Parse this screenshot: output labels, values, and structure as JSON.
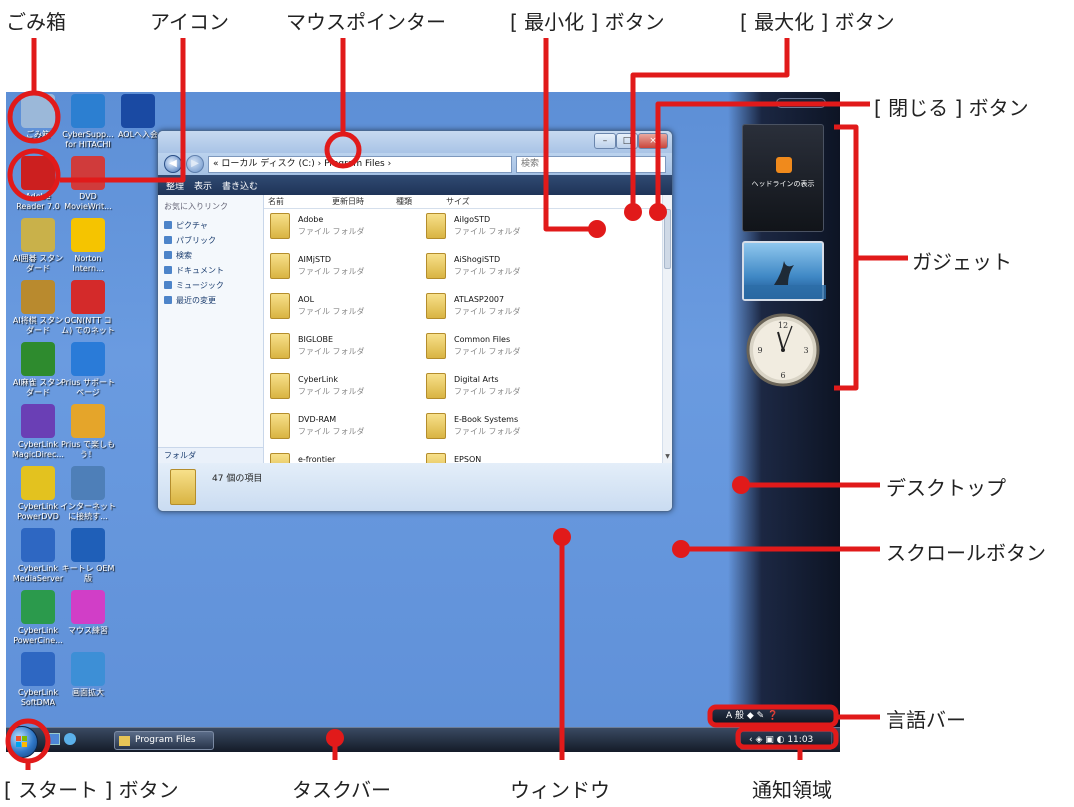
{
  "callouts": {
    "recycle_bin": "ごみ箱",
    "icon": "アイコン",
    "mouse_pointer": "マウスポインター",
    "minimize_button": "[ 最小化 ] ボタン",
    "maximize_button": "[ 最大化 ] ボタン",
    "close_button": "[ 閉じる ] ボタン",
    "gadget": "ガジェット",
    "desktop": "デスクトップ",
    "scroll_button": "スクロールボタン",
    "language_bar": "言語バー",
    "start_button": "[ スタート ] ボタン",
    "taskbar": "タスクバー",
    "window": "ウィンドウ",
    "notification_area": "通知領域"
  },
  "desktop_icons": [
    {
      "label": "ごみ箱",
      "icon": "recycle-bin-icon",
      "color": "#9bb8d9"
    },
    {
      "label": "CyberSupp... for HITACHI",
      "icon": "cybersupport-icon",
      "color": "#2c7fd1"
    },
    {
      "label": "AOLへ入会",
      "icon": "aol-icon",
      "color": "#1a4aa3"
    },
    {
      "label": "Adobe Reader 7.0",
      "icon": "adobe-reader-icon",
      "color": "#cc1f1f"
    },
    {
      "label": "DVD MovieWrit...",
      "icon": "dvd-moviewriter-icon",
      "color": "#d03b3b"
    },
    {
      "label": "AI囲碁 スタンダード",
      "icon": "ai-go-icon",
      "color": "#c9b14a"
    },
    {
      "label": "Norton Intern...",
      "icon": "norton-icon",
      "color": "#f5c400"
    },
    {
      "label": "AI将棋 スタンダード",
      "icon": "ai-shogi-icon",
      "color": "#b98a2e"
    },
    {
      "label": "OCN(NTT コム) でのネット",
      "icon": "ocn-icon",
      "color": "#d42a2a"
    },
    {
      "label": "AI麻雀 スタンダード",
      "icon": "ai-mahjong-icon",
      "color": "#2e8b2e"
    },
    {
      "label": "Prius サポートページ",
      "icon": "prius-support-icon",
      "color": "#2a7bd8"
    },
    {
      "label": "CyberLink MagicDirec...",
      "icon": "magicdirector-icon",
      "color": "#6a3fb5"
    },
    {
      "label": "Prius で楽しもう！",
      "icon": "prius-enjoy-icon",
      "color": "#e5a52a"
    },
    {
      "label": "CyberLink PowerDVD",
      "icon": "powerdvd-icon",
      "color": "#e3c21f"
    },
    {
      "label": "インターネットに接続す...",
      "icon": "internet-connect-icon",
      "color": "#4e7fb8"
    },
    {
      "label": "CyberLink MediaServer",
      "icon": "mediaserver-icon",
      "color": "#2e67c2"
    },
    {
      "label": "キートレ OEM版",
      "icon": "keytore-icon",
      "color": "#1f5fb8"
    },
    {
      "label": "CyberLink PowerCine...",
      "icon": "powercinema-icon",
      "color": "#2b9a4c"
    },
    {
      "label": "マウス練習",
      "icon": "mouse-practice-icon",
      "color": "#d13ec7"
    },
    {
      "label": "CyberLink SoftDMA",
      "icon": "softdma-icon",
      "color": "#2e67c2"
    },
    {
      "label": "画面拡大",
      "icon": "magnifier-icon",
      "color": "#3d8fd6"
    }
  ],
  "sidebar": {
    "rss_label": "ヘッドラインの表示"
  },
  "explorer": {
    "address": "« ローカル ディスク (C:) › Program Files ›",
    "search_placeholder": "検索",
    "toolbar": {
      "organize": "整理",
      "views": "表示",
      "burn": "書き込む"
    },
    "favorites_header": "お気に入りリンク",
    "nav_links": [
      "ピクチャ",
      "パブリック",
      "検索",
      "ドキュメント",
      "ミュージック",
      "最近の変更"
    ],
    "folders_label": "フォルダ",
    "columns": [
      "名前",
      "更新日時",
      "種類",
      "サイズ"
    ],
    "folder_type": "ファイル フォルダ",
    "files": [
      "Adobe",
      "AiIgoSTD",
      "AIMjSTD",
      "AiShogiSTD",
      "AOL",
      "ATLASP2007",
      "BIGLOBE",
      "Common Files",
      "CyberLink",
      "Digital Arts",
      "DVD-RAM",
      "E-Book Systems",
      "e-frontier",
      "EPSON"
    ],
    "item_count": "47 個の項目"
  },
  "taskbar": {
    "program_files_button": "Program Files",
    "clock": "11:03"
  },
  "colors": {
    "annotation_red": "#e11a1a",
    "desktop_blue": "#6497dc"
  }
}
